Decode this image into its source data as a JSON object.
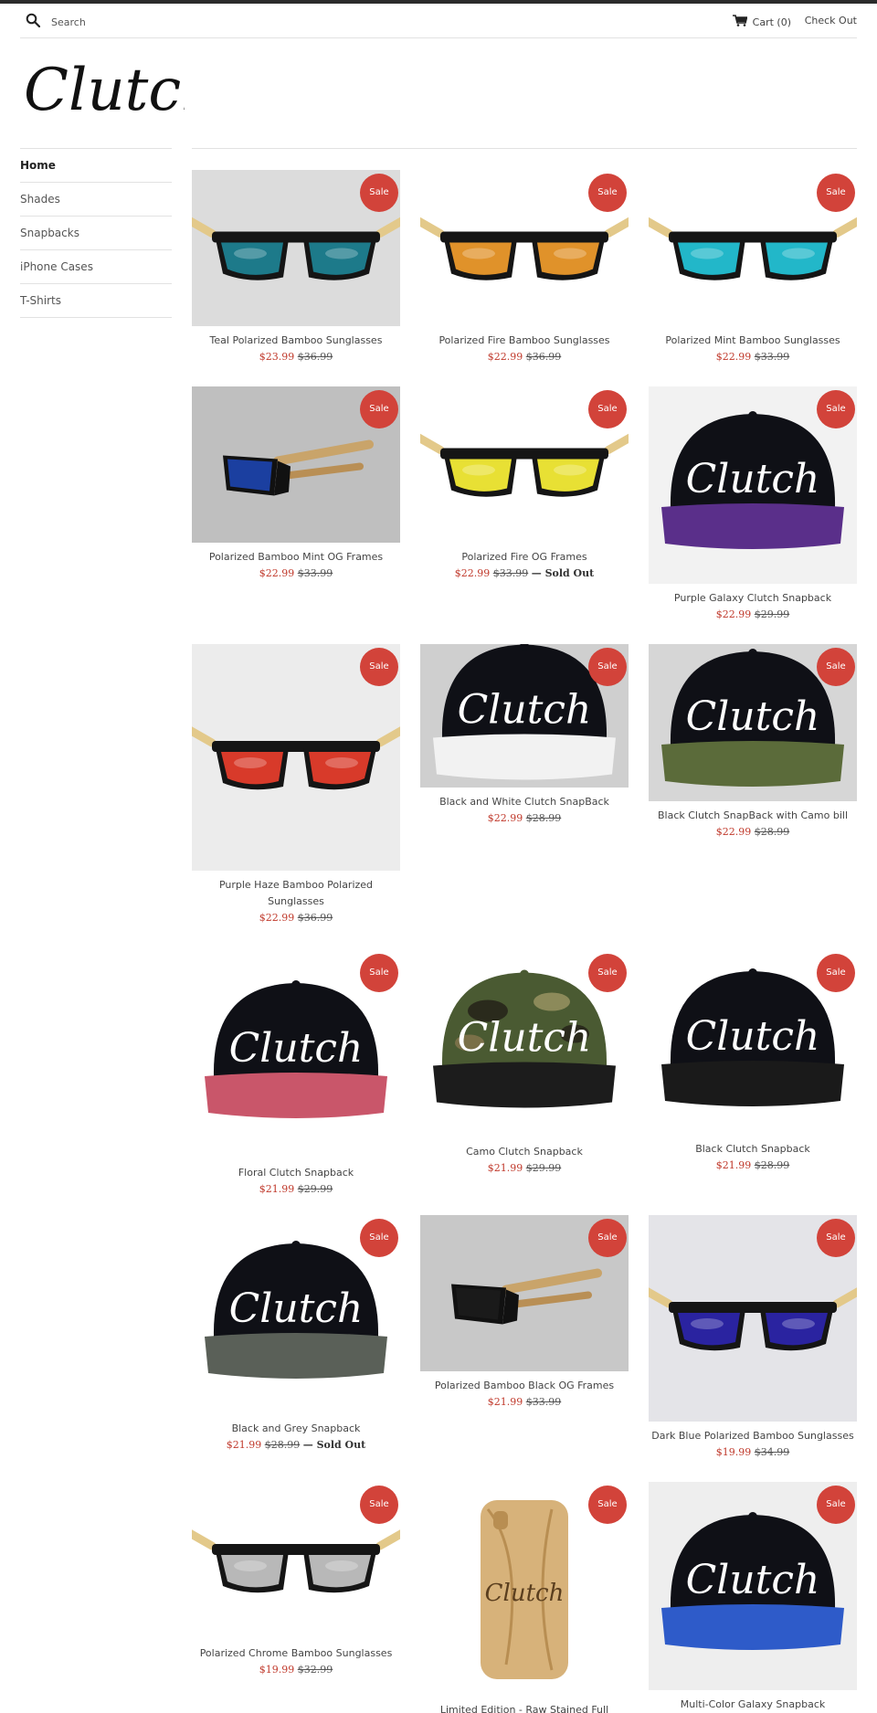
{
  "header": {
    "search_placeholder": "Search",
    "cart_label": "Cart (0)",
    "checkout_label": "Check Out"
  },
  "logo_text": "Clutch",
  "sidebar": {
    "items": [
      {
        "label": "Home",
        "active": true
      },
      {
        "label": "Shades",
        "active": false
      },
      {
        "label": "Snapbacks",
        "active": false
      },
      {
        "label": "iPhone Cases",
        "active": false
      },
      {
        "label": "T-Shirts",
        "active": false
      }
    ]
  },
  "products": [
    {
      "name": "Teal Polarized Bamboo Sunglasses",
      "sale": "$23.99",
      "compare": "$36.99",
      "sold_out": "",
      "badge": "Sale",
      "kind": "glasses",
      "lens": "#1d7a8a",
      "bg": "#dcdcdc"
    },
    {
      "name": "Polarized Fire Bamboo Sunglasses",
      "sale": "$22.99",
      "compare": "$36.99",
      "sold_out": "",
      "badge": "Sale",
      "kind": "glasses",
      "lens": "#e0922a",
      "bg": "#ffffff"
    },
    {
      "name": "Polarized Mint Bamboo Sunglasses",
      "sale": "$22.99",
      "compare": "$33.99",
      "sold_out": "",
      "badge": "Sale",
      "kind": "glasses",
      "lens": "#22b7c9",
      "bg": "#ffffff"
    },
    {
      "name": "Polarized Bamboo Mint OG Frames",
      "sale": "$22.99",
      "compare": "$33.99",
      "sold_out": "",
      "badge": "Sale",
      "kind": "glasses-side",
      "lens": "#1b3fa0",
      "bg": "#bfbfbf"
    },
    {
      "name": "Polarized Fire OG Frames",
      "sale": "$22.99",
      "compare": "$33.99",
      "sold_out": "— Sold Out",
      "badge": "Sale",
      "kind": "glasses",
      "lens": "#e8e034",
      "bg": "#ffffff"
    },
    {
      "name": "Purple Galaxy Clutch Snapback",
      "sale": "$22.99",
      "compare": "$29.99",
      "sold_out": "",
      "badge": "Sale",
      "kind": "cap",
      "brim": "#5a2f8a",
      "bg": "#f2f2f2"
    },
    {
      "name": "Purple Haze Bamboo Polarized Sunglasses",
      "sale": "$22.99",
      "compare": "$36.99",
      "sold_out": "",
      "badge": "Sale",
      "kind": "glasses",
      "lens": "#d83a2a",
      "bg": "#ececec"
    },
    {
      "name": "Black and White Clutch SnapBack",
      "sale": "$22.99",
      "compare": "$28.99",
      "sold_out": "",
      "badge": "Sale",
      "kind": "cap",
      "brim": "#f2f2f2",
      "bg": "#cfcfcf"
    },
    {
      "name": "Black Clutch SnapBack with Camo bill",
      "sale": "$22.99",
      "compare": "$28.99",
      "sold_out": "",
      "badge": "Sale",
      "kind": "cap",
      "brim": "#5b6b3a",
      "bg": "#d6d6d6"
    },
    {
      "name": "Floral Clutch Snapback",
      "sale": "$21.99",
      "compare": "$29.99",
      "sold_out": "",
      "badge": "Sale",
      "kind": "cap",
      "brim": "#c9566a",
      "bg": "#ffffff"
    },
    {
      "name": "Camo Clutch Snapback",
      "sale": "$21.99",
      "compare": "$29.99",
      "sold_out": "",
      "badge": "Sale",
      "kind": "cap-camo",
      "brim": "#1c1c1c",
      "bg": "#ffffff"
    },
    {
      "name": "Black Clutch Snapback",
      "sale": "$21.99",
      "compare": "$28.99",
      "sold_out": "",
      "badge": "Sale",
      "kind": "cap",
      "brim": "#1a1a1a",
      "bg": "#ffffff"
    },
    {
      "name": "Black and Grey Snapback",
      "sale": "$21.99",
      "compare": "$28.99",
      "sold_out": "— Sold Out",
      "badge": "Sale",
      "kind": "cap",
      "brim": "#5a6058",
      "bg": "#ffffff"
    },
    {
      "name": "Polarized Bamboo Black OG Frames",
      "sale": "$21.99",
      "compare": "$33.99",
      "sold_out": "",
      "badge": "Sale",
      "kind": "glasses-side",
      "lens": "#1a1a1a",
      "bg": "#c8c8c8"
    },
    {
      "name": "Dark Blue Polarized Bamboo Sunglasses",
      "sale": "$19.99",
      "compare": "$34.99",
      "sold_out": "",
      "badge": "Sale",
      "kind": "glasses",
      "lens": "#2a23a0",
      "bg": "#e4e4e8"
    },
    {
      "name": "Polarized Chrome Bamboo Sunglasses",
      "sale": "$19.99",
      "compare": "$32.99",
      "sold_out": "",
      "badge": "Sale",
      "kind": "glasses",
      "lens": "#b8b8b8",
      "bg": "#ffffff"
    },
    {
      "name": "Limited Edition - Raw Stained Full",
      "sale": "",
      "compare": "",
      "sold_out": "",
      "badge": "Sale",
      "kind": "case",
      "bg": "#ffffff"
    },
    {
      "name": "Multi-Color Galaxy Snapback",
      "sale": "",
      "compare": "",
      "sold_out": "",
      "badge": "Sale",
      "kind": "cap",
      "brim": "#2e5bc9",
      "bg": "#eeeeee"
    }
  ]
}
